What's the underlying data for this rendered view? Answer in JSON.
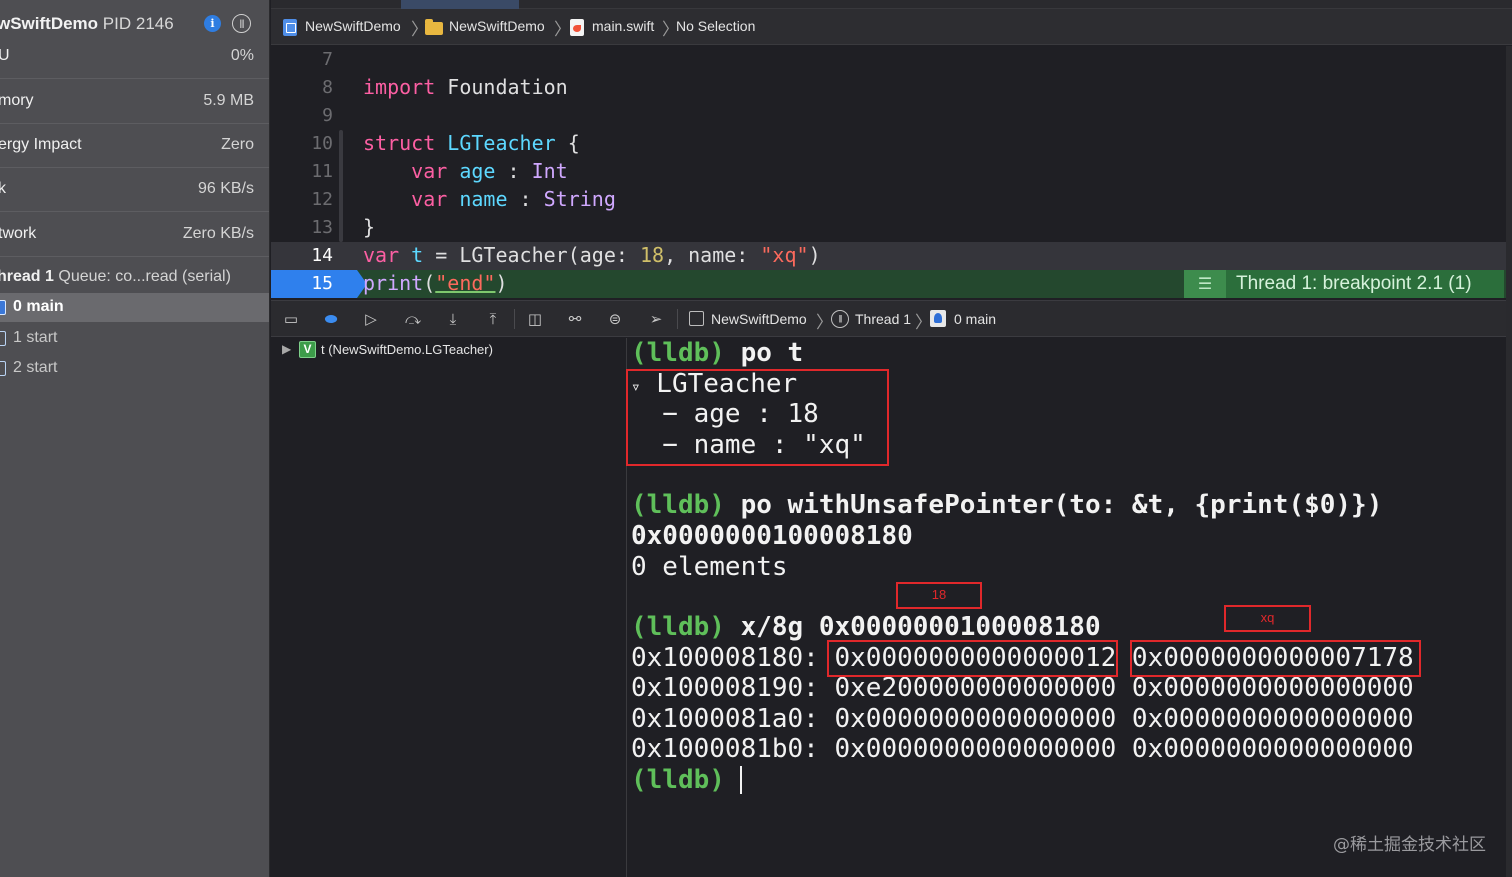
{
  "navigator": {
    "process_name": "wSwiftDemo",
    "process_pid": "PID 2146",
    "gauges": [
      {
        "label": "U",
        "value": "0%"
      },
      {
        "label": "mory",
        "value": "5.9 MB"
      },
      {
        "label": "ergy Impact",
        "value": "Zero"
      },
      {
        "label": "k",
        "value": "96 KB/s"
      },
      {
        "label": "twork",
        "value": "Zero KB/s"
      }
    ],
    "thread_name": "hread 1",
    "thread_queue": "Queue: co...read (serial)",
    "frames": [
      {
        "label": "0 main"
      },
      {
        "label": "1 start"
      },
      {
        "label": "2 start"
      }
    ]
  },
  "jumpbar": {
    "project": "NewSwiftDemo",
    "group": "NewSwiftDemo",
    "file": "main.swift",
    "selection": "No Selection"
  },
  "editor": {
    "line_numbers": [
      "7",
      "8",
      "9",
      "10",
      "11",
      "12",
      "13",
      "14",
      "15"
    ],
    "breakpoint_label": "Thread 1: breakpoint 2.1 (1)"
  },
  "debugbar": {
    "app": "NewSwiftDemo",
    "thread": "Thread 1",
    "frame": "0 main"
  },
  "variables": {
    "item": "t (NewSwiftDemo.LGTeacher)"
  },
  "console": {
    "prompt": "(lldb)",
    "cmd1": "po t",
    "out_type": "LGTeacher",
    "out_age": "  − age : 18",
    "out_name": "  − name : \"xq\"",
    "cmd2": "po withUnsafePointer(to: &t, {print($0)})",
    "out_ptr": "0x0000000100008180",
    "out_elements": "0 elements",
    "cmd3": "x/8g 0x0000000100008180",
    "memory_rows": [
      {
        "addr": "0x100008180:",
        "v1": "0x0000000000000012",
        "v2": "0x0000000000007178"
      },
      {
        "addr": "0x100008190:",
        "v1": "0xe200000000000000",
        "v2": "0x0000000000000000"
      },
      {
        "addr": "0x1000081a0:",
        "v1": "0x0000000000000000",
        "v2": "0x0000000000000000"
      },
      {
        "addr": "0x1000081b0:",
        "v1": "0x0000000000000000",
        "v2": "0x0000000000000000"
      }
    ],
    "annot_age": "18",
    "annot_name": "xq"
  },
  "watermark": "@稀土掘金技术社区"
}
